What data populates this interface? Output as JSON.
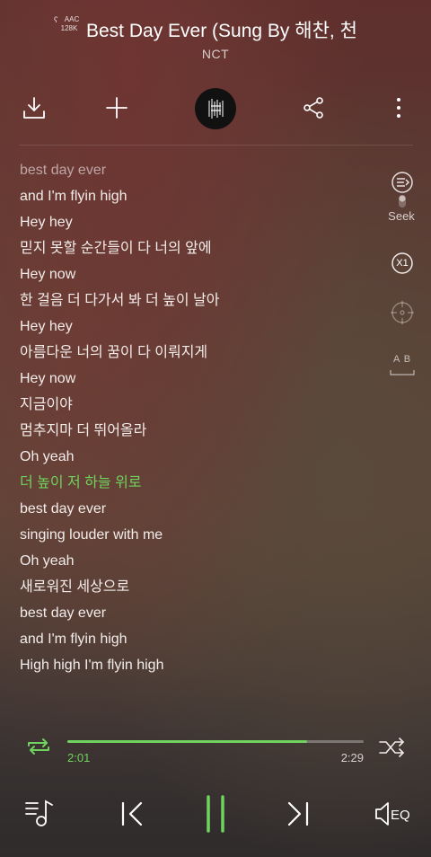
{
  "header": {
    "codec_line1": "AAC",
    "codec_line2": "128K",
    "title": "Best Day Ever (Sung By 해찬, 천",
    "artist": "NCT"
  },
  "toolbar": {
    "icons": [
      "download-icon",
      "add-icon",
      "album-art",
      "share-icon",
      "more-icon"
    ]
  },
  "lyrics": {
    "lines": [
      "best day ever",
      "and I'm flyin high",
      "Hey hey",
      "믿지 못할 순간들이 다 너의 앞에",
      "Hey now",
      "한 걸음 더 다가서 봐 더 높이 날아",
      "Hey hey",
      "아름다운 너의 꿈이 다 이뤄지게",
      "Hey now",
      "지금이야",
      "멈추지마 더 뛰어올라",
      "Oh yeah",
      "더 높이 저 하늘 위로",
      "best day ever",
      "singing louder with me",
      "Oh yeah",
      "새로워진 세상으로",
      "best day ever",
      "and I'm flyin high",
      "High high I'm flyin high"
    ],
    "active_index": 12
  },
  "side": {
    "seek_label": "Seek",
    "speed_label": "X1",
    "ab_label": "A B"
  },
  "progress": {
    "current": "2:01",
    "total": "2:29",
    "fraction": 0.81
  },
  "colors": {
    "accent": "#6fd35d"
  }
}
